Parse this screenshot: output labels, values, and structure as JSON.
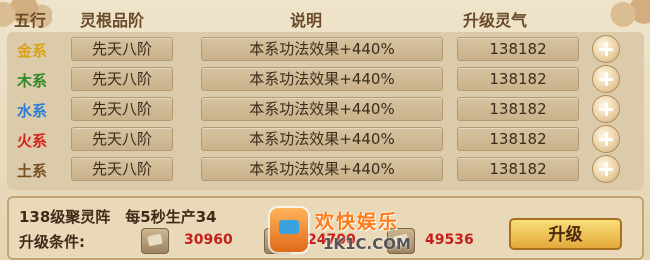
{
  "header": {
    "col_wuxing": "五行",
    "col_pinjie": "灵根品阶",
    "col_shuoming": "说明",
    "col_lingqi": "升级灵气"
  },
  "rows": [
    {
      "element": "金系",
      "color": "#d9a21a",
      "grade": "先天八阶",
      "desc": "本系功法效果+440%",
      "qi": "138182"
    },
    {
      "element": "木系",
      "color": "#2f8a2a",
      "grade": "先天八阶",
      "desc": "本系功法效果+440%",
      "qi": "138182"
    },
    {
      "element": "水系",
      "color": "#2a7fd6",
      "grade": "先天八阶",
      "desc": "本系功法效果+440%",
      "qi": "138182"
    },
    {
      "element": "火系",
      "color": "#d6231b",
      "grade": "先天八阶",
      "desc": "本系功法效果+440%",
      "qi": "138182"
    },
    {
      "element": "土系",
      "color": "#7a4f22",
      "grade": "先天八阶",
      "desc": "本系功法效果+440%",
      "qi": "138182"
    }
  ],
  "bottom": {
    "array_info": "138级聚灵阵　每5秒生产34",
    "condition_label": "升级条件:",
    "materials": [
      {
        "icon": "material-icon",
        "value": "30960"
      },
      {
        "icon": "material-icon",
        "value": "24700"
      },
      {
        "icon": "material-icon",
        "value": "49536"
      }
    ],
    "upgrade_label": "升级"
  },
  "watermark": {
    "text": "欢快娱乐",
    "url": "1K1C.COM"
  }
}
